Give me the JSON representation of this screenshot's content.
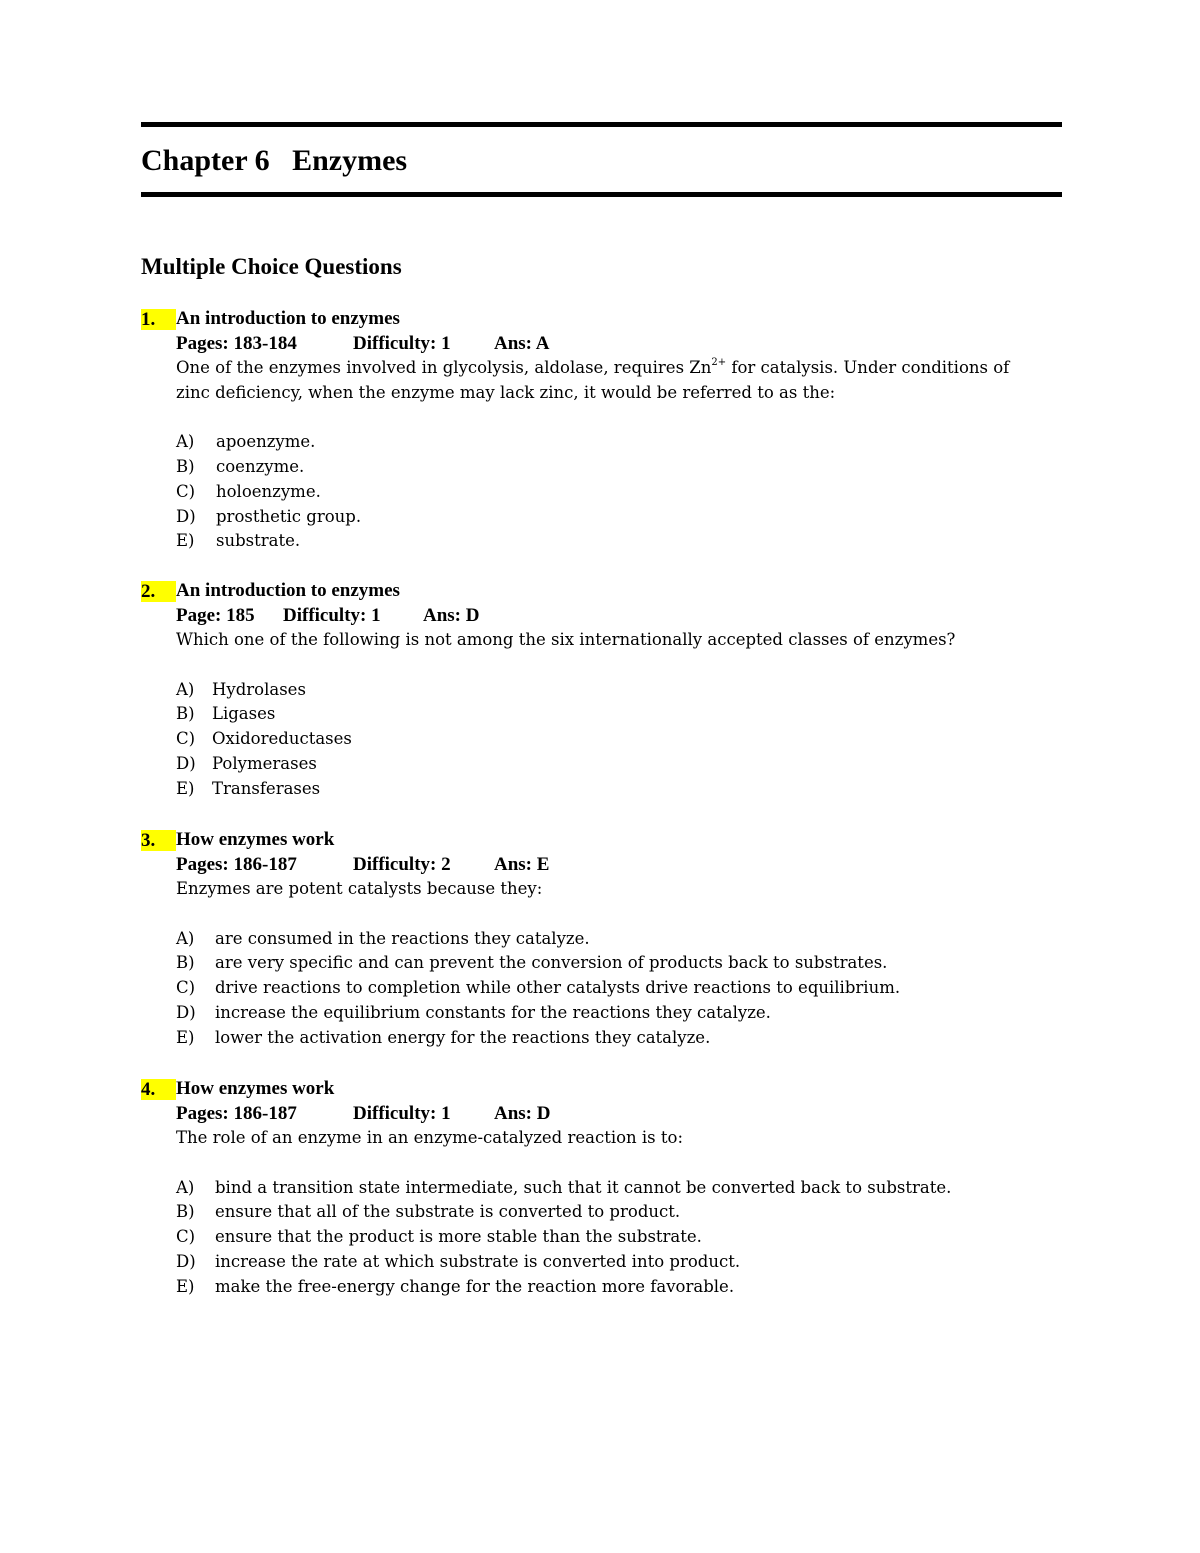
{
  "document": {
    "chapter_title": "Chapter 6   Enzymes",
    "section_title": "Multiple Choice Questions",
    "highlight_color": "#ffff00"
  },
  "questions": [
    {
      "number": "1.",
      "topic": "An introduction to enzymes",
      "pages_label": "Pages: 183-184",
      "difficulty_label": "Difficulty: 1",
      "answer_label": "Ans: A",
      "text_lines": [
        {
          "before": "One of the enzymes involved in glycolysis, aldolase, requires Zn",
          "sup": "2+",
          "after": " for catalysis.  Under conditions of"
        },
        {
          "before": "zinc deficiency, when the enzyme may lack zinc, it would be referred to as the:",
          "sup": "",
          "after": ""
        }
      ],
      "choices": [
        {
          "letter": "A)",
          "text": "apoenzyme."
        },
        {
          "letter": "B)",
          "text": "coenzyme."
        },
        {
          "letter": "C)",
          "text": "holoenzyme."
        },
        {
          "letter": "D)",
          "text": "prosthetic group."
        },
        {
          "letter": "E)",
          "text": "substrate."
        }
      ]
    },
    {
      "number": "2.",
      "topic": "An introduction to enzymes",
      "pages_label": "Page: 185",
      "difficulty_label": "Difficulty: 1",
      "answer_label": "Ans: D",
      "text_lines": [
        {
          "before": "Which one of the following is not among the six internationally accepted classes of enzymes?",
          "sup": "",
          "after": ""
        }
      ],
      "choices": [
        {
          "letter": "A)",
          "text": "Hydrolases"
        },
        {
          "letter": "B)",
          "text": "Ligases"
        },
        {
          "letter": "C)",
          "text": "Oxidoreductases"
        },
        {
          "letter": "D)",
          "text": "Polymerases"
        },
        {
          "letter": "E)",
          "text": "Transferases"
        }
      ]
    },
    {
      "number": "3.",
      "topic": "How enzymes work",
      "pages_label": "Pages: 186-187",
      "difficulty_label": "Difficulty: 2",
      "answer_label": "Ans: E",
      "text_lines": [
        {
          "before": "Enzymes are potent catalysts because they:",
          "sup": "",
          "after": ""
        }
      ],
      "choices": [
        {
          "letter": "A)",
          "text": "are consumed in the reactions they catalyze."
        },
        {
          "letter": "B)",
          "text": "are very specific and can prevent the conversion of products back to substrates."
        },
        {
          "letter": "C)",
          "text": "drive reactions to completion while other catalysts drive reactions to equilibrium."
        },
        {
          "letter": "D)",
          "text": "increase the equilibrium constants for the reactions they catalyze."
        },
        {
          "letter": "E)",
          "text": "lower the activation energy for the reactions they catalyze."
        }
      ]
    },
    {
      "number": "4.",
      "topic": "How enzymes work",
      "pages_label": "Pages: 186-187",
      "difficulty_label": "Difficulty: 1",
      "answer_label": "Ans: D",
      "text_lines": [
        {
          "before": "The role of an enzyme in an enzyme-catalyzed reaction is to:",
          "sup": "",
          "after": ""
        }
      ],
      "choices": [
        {
          "letter": "A)",
          "text": "bind a transition state intermediate, such that it cannot be converted back to substrate."
        },
        {
          "letter": "B)",
          "text": "ensure that all of the substrate is converted to product."
        },
        {
          "letter": "C)",
          "text": "ensure that the product is more stable than the substrate."
        },
        {
          "letter": "D)",
          "text": "increase the rate at which substrate is converted into product."
        },
        {
          "letter": "E)",
          "text": "make the free-energy change for the reaction more favorable."
        }
      ]
    }
  ]
}
